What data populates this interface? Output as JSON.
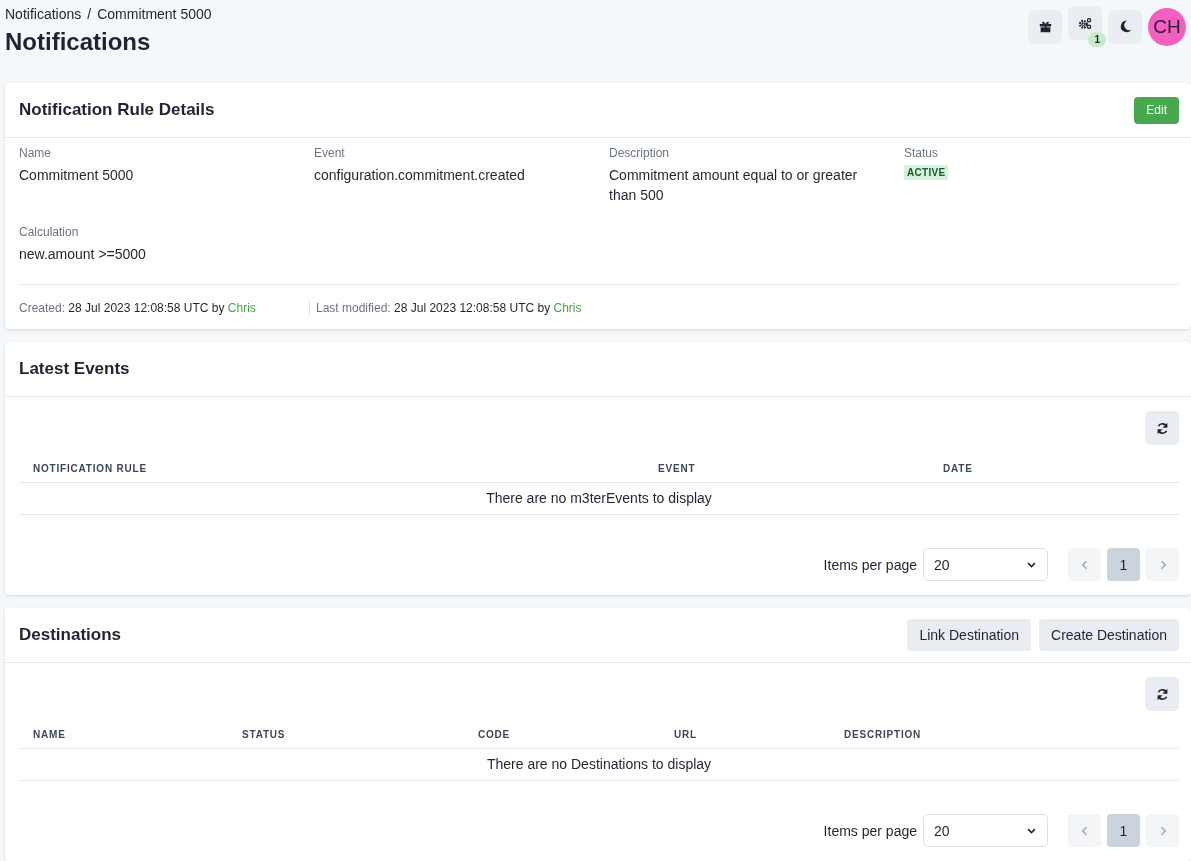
{
  "header": {
    "breadcrumb": [
      {
        "label": "Notifications"
      },
      {
        "label": "Commitment 5000"
      }
    ],
    "separator": "/",
    "title": "Notifications",
    "gear_badge": "1",
    "avatar": "CH"
  },
  "rule_card": {
    "title": "Notification Rule Details",
    "edit_button": "Edit",
    "fields": [
      {
        "label": "Name",
        "value": "Commitment 5000"
      },
      {
        "label": "Event",
        "value": "configuration.commitment.created"
      },
      {
        "label": "Description",
        "value": "Commitment amount equal to or greater than 500"
      }
    ],
    "status": {
      "label": "Status",
      "value": "ACTIVE",
      "kind": "active"
    },
    "calculation": {
      "label": "Calculation",
      "value": "new.amount >=5000"
    },
    "audit": [
      {
        "label": "Created:",
        "date": "28 Jul 2023 12:08:58 UTC",
        "by": "by",
        "user": "Chris"
      },
      {
        "label": "Last modified:",
        "date": "28 Jul 2023 12:08:58 UTC",
        "by": "by",
        "user": "Chris"
      }
    ]
  },
  "events_card": {
    "title": "Latest Events",
    "columns": [
      "NOTIFICATION RULE",
      "EVENT",
      "DATE"
    ],
    "empty_message": "There are no m3terEvents to display",
    "pagination": {
      "label": "Items per page",
      "per_page": "20",
      "pages": [
        {
          "label": "1",
          "selected": true
        }
      ]
    }
  },
  "destinations_card": {
    "title": "Destinations",
    "buttons": [
      "Link Destination",
      "Create Destination"
    ],
    "columns": [
      "NAME",
      "STATUS",
      "CODE",
      "URL",
      "DESCRIPTION"
    ],
    "empty_message": "There are no Destinations to display",
    "pagination": {
      "label": "Items per page",
      "per_page": "20",
      "pages": [
        {
          "label": "1",
          "selected": true
        }
      ]
    }
  }
}
